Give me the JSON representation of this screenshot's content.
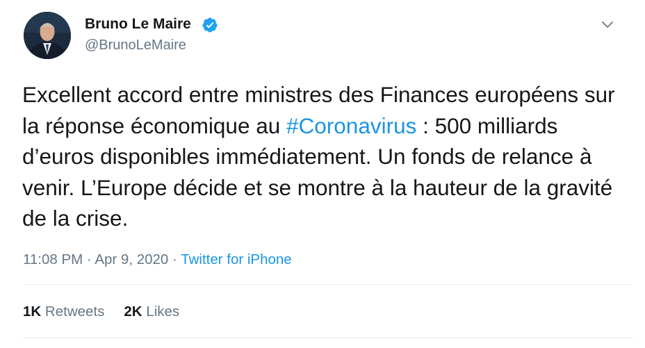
{
  "author": {
    "name": "Bruno Le Maire",
    "handle": "@BrunoLeMaire",
    "verified_icon": "verified-badge-icon",
    "avatar_icon": "profile-photo"
  },
  "menu_icon": "chevron-down-icon",
  "tweet": {
    "text_1": "Excellent accord entre ministres des Finances européens sur la réponse économique au ",
    "hashtag": "#Coronavirus",
    "text_2": " : 500 milliards d’euros disponibles immédiatement. Un fonds de relance à venir. L’Europe décide et se montre à la hauteur de la gravité de la crise."
  },
  "meta": {
    "time": "11:08 PM",
    "sep1": " · ",
    "date": "Apr 9, 2020",
    "sep2": " · ",
    "source": "Twitter for iPhone"
  },
  "stats": {
    "retweets_count": "1K",
    "retweets_label": "Retweets",
    "likes_count": "2K",
    "likes_label": "Likes"
  },
  "colors": {
    "link": "#1b95e0",
    "secondary_text": "#657786",
    "primary_text": "#14171a",
    "divider": "#e6ecf0",
    "verified": "#1da1f2"
  }
}
